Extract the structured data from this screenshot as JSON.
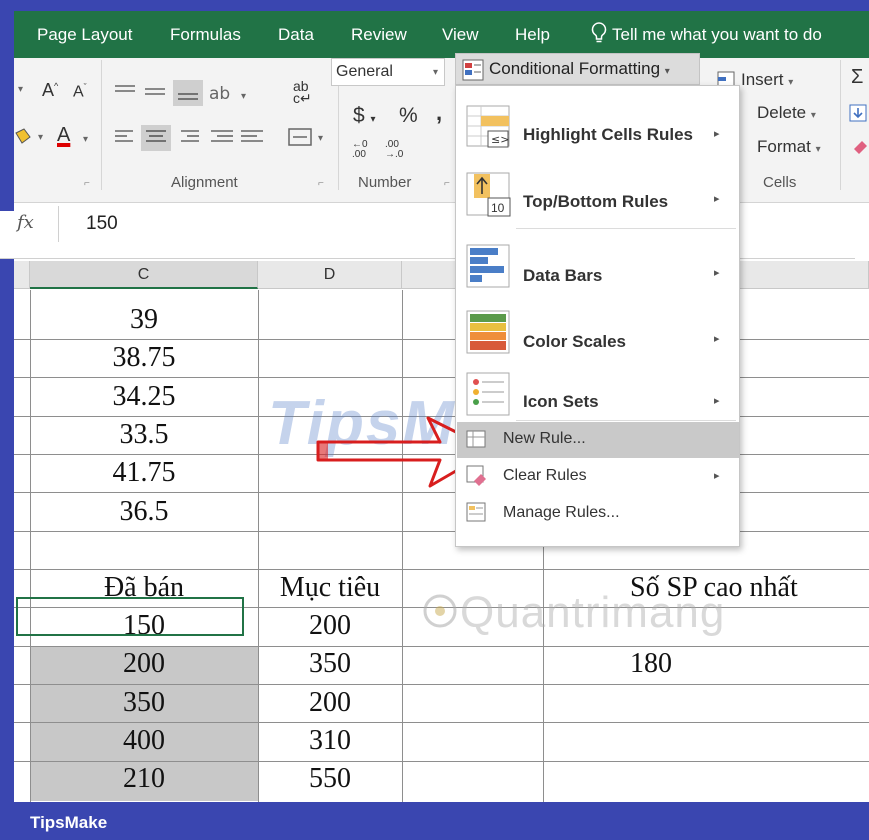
{
  "ribbon_tabs": [
    "Page Layout",
    "Formulas",
    "Data",
    "Review",
    "View",
    "Help"
  ],
  "tell_me": "Tell me what you want to do",
  "ribbon": {
    "font_grow": "A",
    "font_shrink": "A",
    "alignment_label": "Alignment",
    "number_label": "Number",
    "number_format": "General",
    "currency": "$",
    "percent": "%",
    "comma": ",",
    "inc_decimal": ".00",
    "dec_decimal": ".0",
    "conditional_formatting": "Conditional Formatting",
    "insert": "Insert",
    "delete": "Delete",
    "format": "Format",
    "cells_label": "Cells",
    "wrap_icon_text": "ab"
  },
  "formula_bar": {
    "fx": "fx",
    "value": "150"
  },
  "column_headers": [
    "C",
    "D"
  ],
  "upper_values": [
    "39",
    "38.75",
    "34.25",
    "33.5",
    "41.75",
    "36.5"
  ],
  "table": {
    "headers": [
      "Đã bán",
      "Mục tiêu",
      "Số SP cao nhất"
    ],
    "rows": [
      {
        "sold": "150",
        "target": "200"
      },
      {
        "sold": "200",
        "target": "350"
      },
      {
        "sold": "350",
        "target": "200"
      },
      {
        "sold": "400",
        "target": "310"
      },
      {
        "sold": "210",
        "target": "550"
      }
    ],
    "max_value": "180"
  },
  "menu": {
    "highlight_cells_rules": "Highlight Cells Rules",
    "top_bottom_rules": "Top/Bottom Rules",
    "data_bars": "Data Bars",
    "color_scales": "Color Scales",
    "icon_sets": "Icon Sets",
    "new_rule": "New Rule...",
    "clear_rules": "Clear Rules",
    "manage_rules": "Manage Rules...",
    "top_bottom_icon_num": "10"
  },
  "watermarks": {
    "tipsmake": "TipsMake",
    "quantrimang": "Quantrimang"
  },
  "footer": "TipsMake",
  "colors": {
    "excel_green": "#217346",
    "frame_blue": "#3a46b0",
    "selected_fill": "#c8c8c8"
  }
}
